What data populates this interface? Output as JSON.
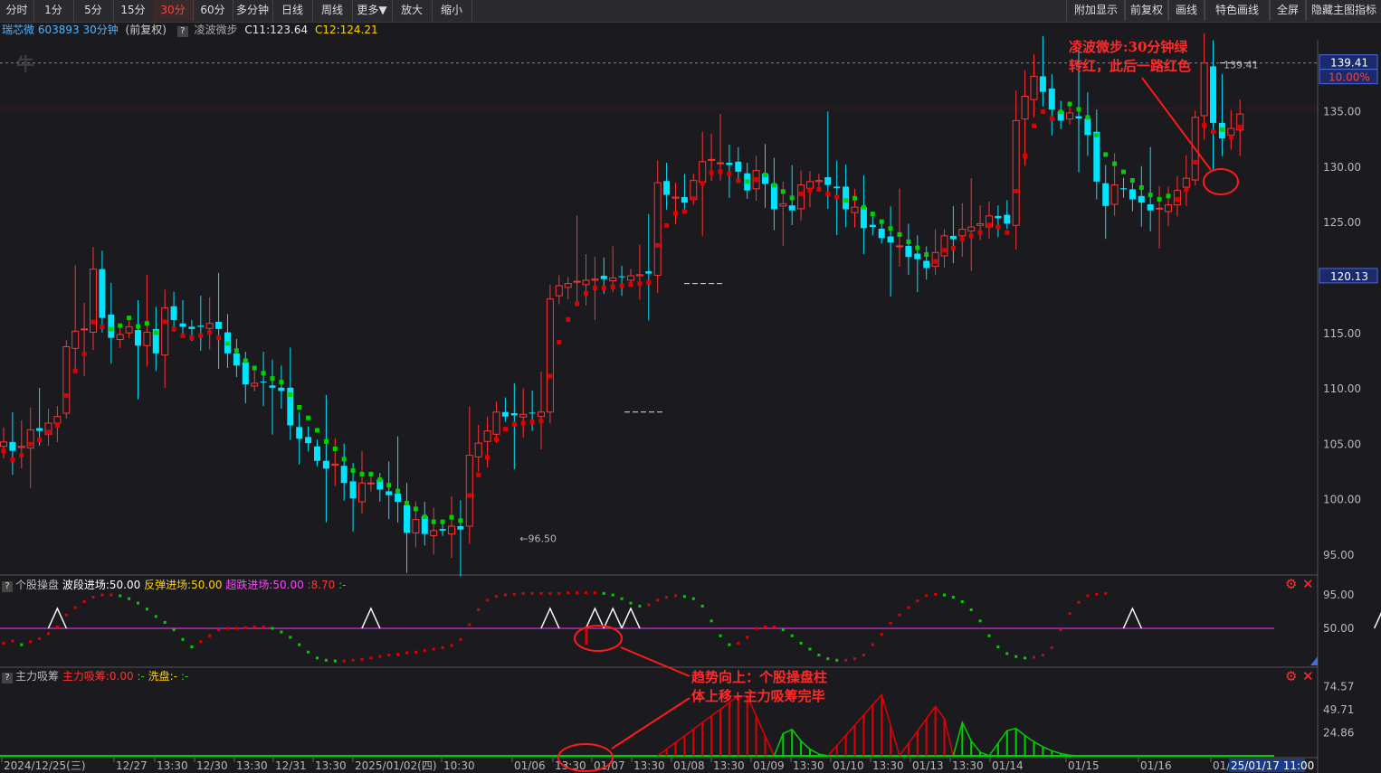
{
  "toolbar": {
    "left": [
      "分时",
      "1分",
      "5分",
      "15分",
      "30分",
      "60分",
      "多分钟",
      "日线",
      "周线",
      "更多▼",
      "放大",
      "缩小"
    ],
    "active": "30分",
    "right": [
      "附加显示",
      "前复权",
      "画线",
      "特色画线",
      "全屏",
      "隐藏主图指标"
    ]
  },
  "info": {
    "stock": "瑞芯微 603893 30分钟",
    "adj": "(前复权)",
    "indicator_name": "凌波微步",
    "c11": "C11:123.64",
    "c12": "C12:124.21"
  },
  "annotations": {
    "top_line1": "凌波微步:30分钟绿",
    "top_line2": "转红，此后一路红色",
    "bottom_line1": "趋势向上：个股操盘柱",
    "bottom_line2": "体上移+主力吸筹完毕"
  },
  "price_labels": {
    "high_value": "139.41",
    "pct": "10.00%",
    "current": "120.13",
    "low_marker": "96.50",
    "high_marker": "139.41"
  },
  "sub1": {
    "title": "个股操盘",
    "l1": "波段进场:50.00",
    "l2": "反弹进场:50.00",
    "l3": "超跌进场:50.00",
    "l4": ":8.70",
    "l5": ":-"
  },
  "sub2": {
    "title": "主力吸筹",
    "l1": "主力吸筹:0.00",
    "l2": ":-",
    "l3": "洗盘:-",
    "l4": ":-"
  },
  "colors": {
    "up": "#ff3232",
    "down": "#00e5ff",
    "green": "#00d000",
    "red": "#e00000",
    "magenta": "#cc33cc"
  },
  "chart_data": [
    {
      "type": "candlestick",
      "title": "瑞芯微 603893 30分钟",
      "y_ticks": [
        "135.00",
        "130.00",
        "125.00",
        "120.00",
        "115.00",
        "110.00",
        "105.00",
        "100.00",
        "95.00"
      ],
      "x_ticks": [
        "2024/12/25(三)",
        "12/27",
        "13:30",
        "12/30",
        "13:30",
        "12/31",
        "13:30",
        "2025/01/02(四)",
        "10:30",
        "01/06",
        "13:30",
        "01/07",
        "13:30",
        "01/08",
        "13:30",
        "01/09",
        "13:30",
        "01/10",
        "13:30",
        "01/13",
        "13:30",
        "01/14",
        "01/15",
        "01/16",
        "01/1"
      ],
      "x_cursor_label": "25/01/17 11:00",
      "ylim": [
        94.5,
        141.5
      ],
      "closes": [
        105.2,
        104.4,
        104.8,
        106.3,
        106.2,
        106.9,
        107.5,
        113.8,
        115.2,
        115.4,
        120.8,
        116.4,
        114.6,
        114.9,
        115.6,
        113.9,
        115.1,
        113.2,
        117.3,
        116.2,
        115.6,
        115.4,
        115.6,
        115.9,
        115.4,
        113.2,
        112.1,
        110.4,
        110.5,
        110.6,
        110.1,
        109.8,
        106.7,
        105.5,
        105.1,
        103.5,
        102.8,
        103.2,
        101.5,
        100.1,
        101.5,
        101.5,
        100.9,
        100.4,
        99.8,
        97.0,
        98.2,
        96.9,
        97.2,
        97.2,
        97.6,
        97.3,
        104.0,
        105.1,
        106.2,
        107.9,
        107.5,
        107.6,
        107.7,
        107.8,
        107.9,
        118.1,
        119.3,
        119.5,
        119.7,
        119.8,
        119.9,
        119.9,
        120.0,
        120.1,
        120.2,
        120.3,
        120.4,
        128.6,
        127.5,
        127.3,
        126.8,
        128.8,
        130.5,
        130.7,
        130.4,
        130.2,
        129.6,
        127.9,
        129.7,
        128.5,
        126.2,
        126.7,
        126.1,
        128.4,
        128.7,
        128.8,
        128.4,
        128.1,
        126.2,
        126.4,
        124.5,
        124.6,
        123.6,
        123.2,
        122.9,
        121.9,
        121.7,
        120.9,
        122.3,
        123.8,
        123.5,
        124.4,
        124.6,
        124.9,
        125.6,
        125.4,
        124.9,
        134.2,
        136.4,
        138.2,
        136.8,
        135.2,
        134.2,
        134.9,
        134.4,
        132.9,
        128.7,
        126.5,
        128.4,
        128.0,
        127.1,
        126.8,
        126.1,
        126.3,
        126.6,
        127.9,
        129.0,
        134.5,
        139.4,
        134.0,
        132.6,
        133.5,
        134.8
      ],
      "support_line": {
        "name": "凌波微步",
        "colors": [
          "red",
          "green"
        ]
      },
      "horizontal_marks": [
        107.9,
        119.5,
        139.41
      ]
    },
    {
      "type": "line",
      "title": "个股操盘",
      "y_ticks": [
        "95.00",
        "50.00"
      ],
      "ylim": [
        0,
        100
      ],
      "values": [
        30,
        33,
        28,
        32,
        36,
        43,
        52,
        68,
        78,
        86,
        92,
        95,
        95,
        94,
        90,
        84,
        76,
        66,
        58,
        48,
        35,
        25,
        32,
        40,
        48,
        50,
        50,
        51,
        52,
        52,
        50,
        45,
        38,
        28,
        18,
        10,
        7,
        6,
        6,
        7,
        8,
        10,
        12,
        14,
        15,
        17,
        18,
        20,
        22,
        24,
        27,
        35,
        55,
        75,
        88,
        93,
        95,
        96,
        97,
        97,
        97,
        97,
        97,
        98,
        98,
        98,
        98,
        97,
        95,
        90,
        84,
        80,
        82,
        88,
        92,
        94,
        93,
        90,
        80,
        60,
        40,
        28,
        30,
        38,
        50,
        52,
        52,
        48,
        40,
        30,
        22,
        14,
        9,
        7,
        7,
        9,
        14,
        28,
        42,
        57,
        68,
        78,
        87,
        94,
        96,
        95,
        92,
        86,
        75,
        60,
        40,
        25,
        16,
        12,
        10,
        11,
        14,
        24,
        48,
        70,
        85,
        94,
        96,
        97
      ],
      "threshold": 50,
      "signal_marks": [
        6,
        41,
        61,
        66,
        68,
        70,
        126,
        154
      ]
    },
    {
      "type": "area",
      "title": "主力吸筹",
      "y_ticks": [
        "74.57",
        "49.71",
        "24.86"
      ],
      "ylim": [
        0,
        80
      ],
      "bursts": [
        {
          "start": 73,
          "end": 86,
          "peak": 70,
          "color": "red"
        },
        {
          "start": 86,
          "end": 92,
          "peak": 36,
          "color": "green"
        },
        {
          "start": 92,
          "end": 100,
          "peak": 66,
          "color": "red"
        },
        {
          "start": 100,
          "end": 106,
          "peak": 60,
          "color": "red"
        },
        {
          "start": 106,
          "end": 110,
          "peak": 36,
          "color": "green"
        },
        {
          "start": 110,
          "end": 120,
          "peak": 34,
          "color": "green"
        }
      ]
    }
  ]
}
